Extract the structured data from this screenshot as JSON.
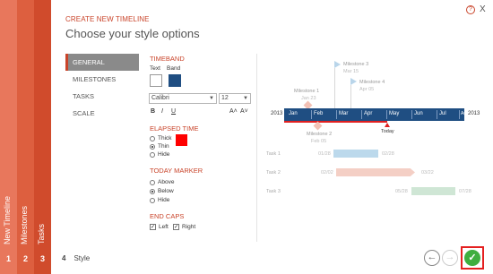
{
  "steps": [
    {
      "label": "New Timeline",
      "number": "1"
    },
    {
      "label": "Milestones",
      "number": "2"
    },
    {
      "label": "Tasks",
      "number": "3"
    }
  ],
  "current_step": {
    "number": "4",
    "label": "Style"
  },
  "header": {
    "subtitle": "CREATE NEW TIMELINE",
    "title": "Choose your style options"
  },
  "top_icons": {
    "help": "?",
    "close": "X"
  },
  "nav": [
    "GENERAL",
    "MILESTONES",
    "TASKS",
    "SCALE"
  ],
  "timeband": {
    "heading": "TIMEBAND",
    "text_label": "Text",
    "band_label": "Band",
    "text_color": "#ffffff",
    "band_color": "#1f4e82",
    "font": "Calibri",
    "size": "12",
    "bold": "B",
    "italic": "I",
    "underline": "U",
    "grow": "A˄",
    "shrink": "A˅"
  },
  "elapsed": {
    "heading": "ELAPSED TIME",
    "options": [
      "Thick",
      "Thin",
      "Hide"
    ],
    "selected": "Thin",
    "color": "#ff0000"
  },
  "today_marker": {
    "heading": "TODAY MARKER",
    "options": [
      "Above",
      "Below",
      "Hide"
    ],
    "selected": "Below"
  },
  "end_caps": {
    "heading": "END CAPS",
    "left": "Left",
    "right": "Right"
  },
  "preview": {
    "year_left": "2013",
    "year_right": "2013",
    "months": [
      "Jan",
      "Feb",
      "Mar",
      "Apr",
      "May",
      "Jun",
      "Jul",
      "Aug"
    ],
    "today": "Today",
    "milestones": [
      {
        "name": "Milestone 1",
        "date": "Jan 23"
      },
      {
        "name": "Milestone 2",
        "date": "Feb 05"
      },
      {
        "name": "Milestone 3",
        "date": "Mar 15"
      },
      {
        "name": "Milestone 4",
        "date": "Apr 05"
      }
    ],
    "tasks": [
      {
        "name": "Task 1",
        "start": "01/28",
        "end": "02/28",
        "color": "#bcd9ec"
      },
      {
        "name": "Task 2",
        "start": "02/02",
        "end": "03/22",
        "color": "#f4cfc5"
      },
      {
        "name": "Task 3",
        "start": "05/28",
        "end": "07/28",
        "color": "#cfe6d5"
      }
    ]
  },
  "colors": {
    "accent": "#c9442a",
    "strip1": "#e8775c",
    "strip2": "#dd5f3f",
    "strip3": "#d04b2c"
  }
}
